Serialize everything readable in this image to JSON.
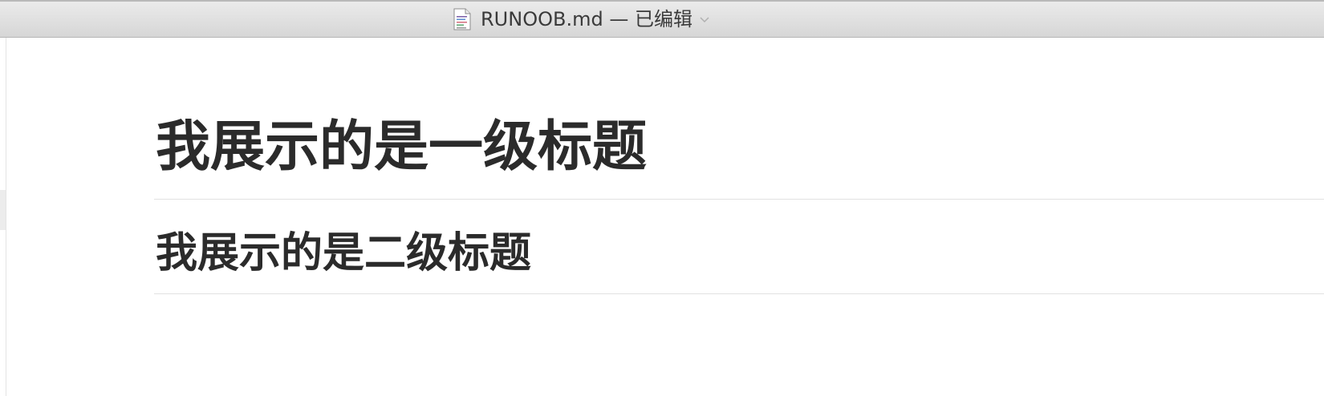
{
  "window": {
    "title": "RUNOOB.md — 已编辑",
    "document_icon": "document-icon",
    "title_menu_icon": "chevron-down-icon"
  },
  "document": {
    "heading_1": "我展示的是一级标题",
    "heading_2": "我展示的是二级标题"
  }
}
